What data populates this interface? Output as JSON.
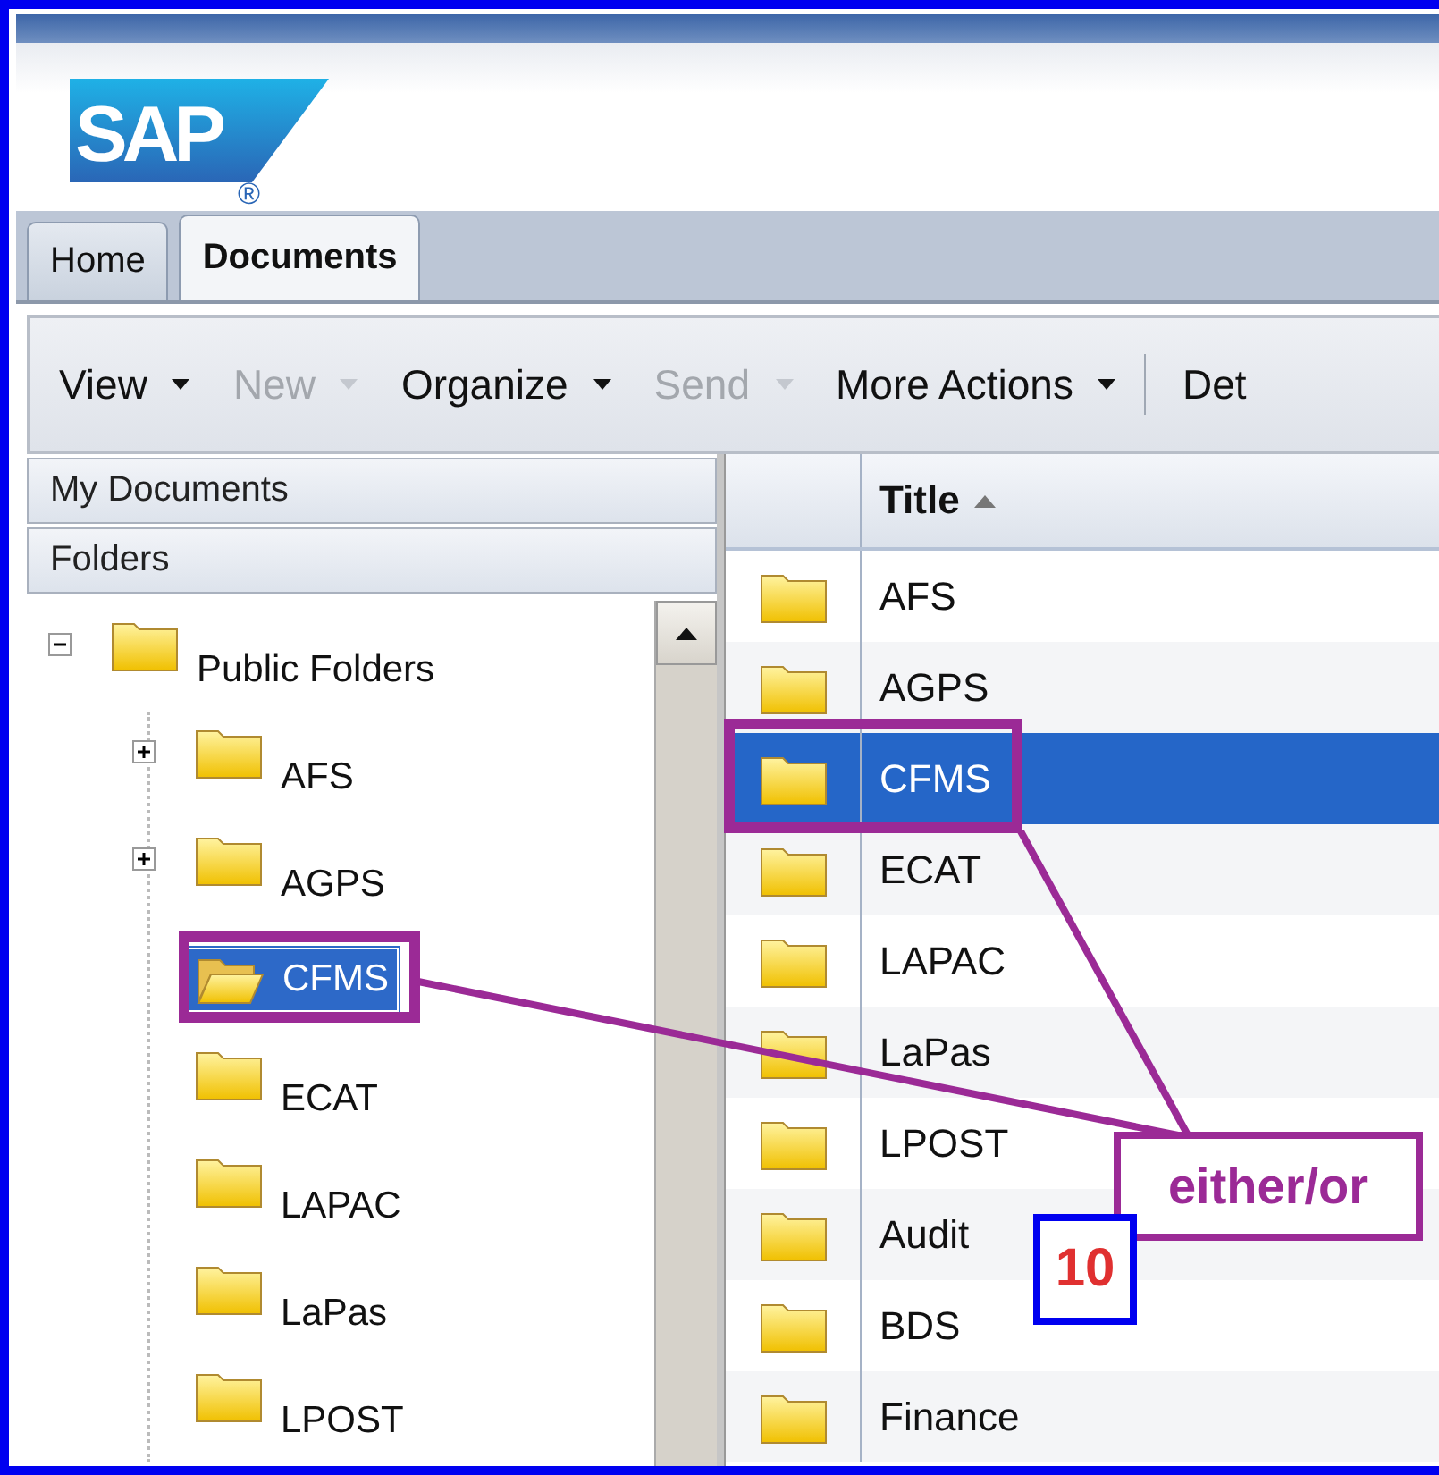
{
  "logo": {
    "text": "SAP",
    "mark": "®"
  },
  "tabs": [
    {
      "label": "Home",
      "selected": false
    },
    {
      "label": "Documents",
      "selected": true
    }
  ],
  "toolbar": [
    {
      "label": "View",
      "kind": "menu",
      "disabled": false
    },
    {
      "label": "New",
      "kind": "menu",
      "disabled": true
    },
    {
      "label": "Organize",
      "kind": "menu",
      "disabled": false
    },
    {
      "label": "Send",
      "kind": "menu",
      "disabled": true
    },
    {
      "label": "More Actions",
      "kind": "menu",
      "disabled": false
    },
    {
      "label": "Det",
      "kind": "button",
      "disabled": false
    }
  ],
  "sidebar": {
    "sections": [
      "My Documents",
      "Folders"
    ]
  },
  "tree": [
    {
      "label": "Public Folders",
      "kind": "branch",
      "expanded": true,
      "selected": false,
      "children": [
        {
          "label": "AFS",
          "kind": "branch",
          "expanded": false,
          "selected": false
        },
        {
          "label": "AGPS",
          "kind": "branch",
          "expanded": false,
          "selected": false
        },
        {
          "label": "CFMS",
          "kind": "leaf",
          "selected": true
        },
        {
          "label": "ECAT",
          "kind": "leaf",
          "selected": false
        },
        {
          "label": "LAPAC",
          "kind": "leaf",
          "selected": false
        },
        {
          "label": "LaPas",
          "kind": "leaf",
          "selected": false
        },
        {
          "label": "LPOST",
          "kind": "leaf",
          "selected": false
        }
      ]
    }
  ],
  "table": {
    "columns": [
      "Title"
    ],
    "rows": [
      {
        "title": "AFS",
        "selected": false
      },
      {
        "title": "AGPS",
        "selected": false
      },
      {
        "title": "CFMS",
        "selected": true
      },
      {
        "title": "ECAT",
        "selected": false
      },
      {
        "title": "LAPAC",
        "selected": false
      },
      {
        "title": "LaPas",
        "selected": false
      },
      {
        "title": "LPOST",
        "selected": false
      },
      {
        "title": "Audit",
        "selected": false
      },
      {
        "title": "BDS",
        "selected": false
      },
      {
        "title": "Finance",
        "selected": false
      }
    ]
  },
  "annotations": {
    "callout": "either/or",
    "step_number": "10"
  }
}
